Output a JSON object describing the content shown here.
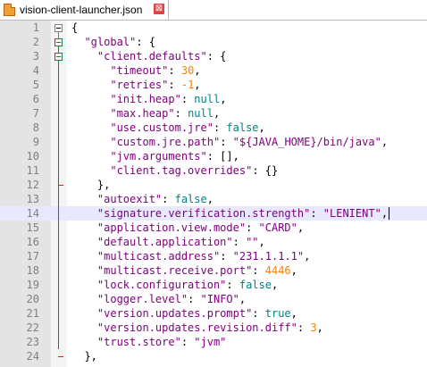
{
  "tab": {
    "filename": "vision-client-launcher.json",
    "close_glyph": "⊠",
    "icon": "json-file-icon"
  },
  "lines": [
    {
      "n": "1",
      "segs": [
        {
          "t": "{",
          "c": "p"
        }
      ]
    },
    {
      "n": "2",
      "segs": [
        {
          "t": "  "
        },
        {
          "t": "\"global\"",
          "c": "k"
        },
        {
          "t": ": {",
          "c": "p"
        }
      ]
    },
    {
      "n": "3",
      "segs": [
        {
          "t": "    "
        },
        {
          "t": "\"client.defaults\"",
          "c": "k"
        },
        {
          "t": ": {",
          "c": "p"
        }
      ]
    },
    {
      "n": "4",
      "segs": [
        {
          "t": "      "
        },
        {
          "t": "\"timeout\"",
          "c": "k"
        },
        {
          "t": ": ",
          "c": "p"
        },
        {
          "t": "30",
          "c": "n"
        },
        {
          "t": ",",
          "c": "p"
        }
      ]
    },
    {
      "n": "5",
      "segs": [
        {
          "t": "      "
        },
        {
          "t": "\"retries\"",
          "c": "k"
        },
        {
          "t": ": ",
          "c": "p"
        },
        {
          "t": "-1",
          "c": "n"
        },
        {
          "t": ",",
          "c": "p"
        }
      ]
    },
    {
      "n": "6",
      "segs": [
        {
          "t": "      "
        },
        {
          "t": "\"init.heap\"",
          "c": "k"
        },
        {
          "t": ": ",
          "c": "p"
        },
        {
          "t": "null",
          "c": "b"
        },
        {
          "t": ",",
          "c": "p"
        }
      ]
    },
    {
      "n": "7",
      "segs": [
        {
          "t": "      "
        },
        {
          "t": "\"max.heap\"",
          "c": "k"
        },
        {
          "t": ": ",
          "c": "p"
        },
        {
          "t": "null",
          "c": "b"
        },
        {
          "t": ",",
          "c": "p"
        }
      ]
    },
    {
      "n": "8",
      "segs": [
        {
          "t": "      "
        },
        {
          "t": "\"use.custom.jre\"",
          "c": "k"
        },
        {
          "t": ": ",
          "c": "p"
        },
        {
          "t": "false",
          "c": "b"
        },
        {
          "t": ",",
          "c": "p"
        }
      ]
    },
    {
      "n": "9",
      "segs": [
        {
          "t": "      "
        },
        {
          "t": "\"custom.jre.path\"",
          "c": "k"
        },
        {
          "t": ": ",
          "c": "p"
        },
        {
          "t": "\"${JAVA_HOME}/bin/java\"",
          "c": "s"
        },
        {
          "t": ",",
          "c": "p"
        }
      ]
    },
    {
      "n": "10",
      "segs": [
        {
          "t": "      "
        },
        {
          "t": "\"jvm.arguments\"",
          "c": "k"
        },
        {
          "t": ": [],",
          "c": "p"
        }
      ]
    },
    {
      "n": "11",
      "segs": [
        {
          "t": "      "
        },
        {
          "t": "\"client.tag.overrides\"",
          "c": "k"
        },
        {
          "t": ": {}",
          "c": "p"
        }
      ]
    },
    {
      "n": "12",
      "segs": [
        {
          "t": "    },",
          "c": "p"
        }
      ]
    },
    {
      "n": "13",
      "segs": [
        {
          "t": "    "
        },
        {
          "t": "\"autoexit\"",
          "c": "k"
        },
        {
          "t": ": ",
          "c": "p"
        },
        {
          "t": "false",
          "c": "b"
        },
        {
          "t": ",",
          "c": "p"
        }
      ]
    },
    {
      "n": "14",
      "segs": [
        {
          "t": "    "
        },
        {
          "t": "\"signature.verification.strength\"",
          "c": "k"
        },
        {
          "t": ": ",
          "c": "p"
        },
        {
          "t": "\"LENIENT\"",
          "c": "s"
        },
        {
          "t": ",",
          "c": "p"
        }
      ],
      "current": true
    },
    {
      "n": "15",
      "segs": [
        {
          "t": "    "
        },
        {
          "t": "\"application.view.mode\"",
          "c": "k"
        },
        {
          "t": ": ",
          "c": "p"
        },
        {
          "t": "\"CARD\"",
          "c": "s"
        },
        {
          "t": ",",
          "c": "p"
        }
      ]
    },
    {
      "n": "16",
      "segs": [
        {
          "t": "    "
        },
        {
          "t": "\"default.application\"",
          "c": "k"
        },
        {
          "t": ": ",
          "c": "p"
        },
        {
          "t": "\"\"",
          "c": "s"
        },
        {
          "t": ",",
          "c": "p"
        }
      ]
    },
    {
      "n": "17",
      "segs": [
        {
          "t": "    "
        },
        {
          "t": "\"multicast.address\"",
          "c": "k"
        },
        {
          "t": ": ",
          "c": "p"
        },
        {
          "t": "\"231.1.1.1\"",
          "c": "s"
        },
        {
          "t": ",",
          "c": "p"
        }
      ]
    },
    {
      "n": "18",
      "segs": [
        {
          "t": "    "
        },
        {
          "t": "\"multicast.receive.port\"",
          "c": "k"
        },
        {
          "t": ": ",
          "c": "p"
        },
        {
          "t": "4446",
          "c": "n"
        },
        {
          "t": ",",
          "c": "p"
        }
      ]
    },
    {
      "n": "19",
      "segs": [
        {
          "t": "    "
        },
        {
          "t": "\"lock.configuration\"",
          "c": "k"
        },
        {
          "t": ": ",
          "c": "p"
        },
        {
          "t": "false",
          "c": "b"
        },
        {
          "t": ",",
          "c": "p"
        }
      ]
    },
    {
      "n": "20",
      "segs": [
        {
          "t": "    "
        },
        {
          "t": "\"logger.level\"",
          "c": "k"
        },
        {
          "t": ": ",
          "c": "p"
        },
        {
          "t": "\"INFO\"",
          "c": "s"
        },
        {
          "t": ",",
          "c": "p"
        }
      ]
    },
    {
      "n": "21",
      "segs": [
        {
          "t": "    "
        },
        {
          "t": "\"version.updates.prompt\"",
          "c": "k"
        },
        {
          "t": ": ",
          "c": "p"
        },
        {
          "t": "true",
          "c": "b"
        },
        {
          "t": ",",
          "c": "p"
        }
      ]
    },
    {
      "n": "22",
      "segs": [
        {
          "t": "    "
        },
        {
          "t": "\"version.updates.revision.diff\"",
          "c": "k"
        },
        {
          "t": ": ",
          "c": "p"
        },
        {
          "t": "3",
          "c": "n"
        },
        {
          "t": ",",
          "c": "p"
        }
      ]
    },
    {
      "n": "23",
      "segs": [
        {
          "t": "    "
        },
        {
          "t": "\"trust.store\"",
          "c": "k"
        },
        {
          "t": ": ",
          "c": "p"
        },
        {
          "t": "\"jvm\"",
          "c": "s"
        }
      ]
    },
    {
      "n": "24",
      "segs": [
        {
          "t": "  },",
          "c": "p"
        }
      ]
    }
  ],
  "colors": {
    "key": "#800080",
    "number": "#ff8000",
    "boolean": "#008080",
    "fold_active": "#e02020",
    "line_number": "#808080",
    "current_line_bg": "#e8e8ff"
  }
}
